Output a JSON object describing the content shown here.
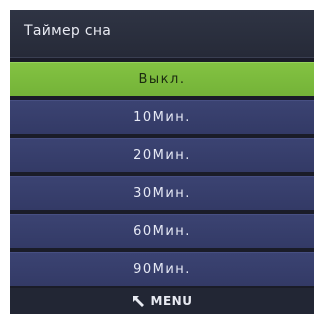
{
  "header": {
    "title": "Таймер сна"
  },
  "menu": {
    "items": [
      {
        "label": "Выкл.",
        "selected": true
      },
      {
        "label": "10Мин.",
        "selected": false
      },
      {
        "label": "20Мин.",
        "selected": false
      },
      {
        "label": "30Мин.",
        "selected": false
      },
      {
        "label": "60Мин.",
        "selected": false
      },
      {
        "label": "90Мин.",
        "selected": false
      }
    ]
  },
  "footer": {
    "back_icon": "back-arrow-icon",
    "label": "MENU"
  },
  "colors": {
    "background": "#1a1c28",
    "item": "#3b4372",
    "selected": "#83c242"
  }
}
